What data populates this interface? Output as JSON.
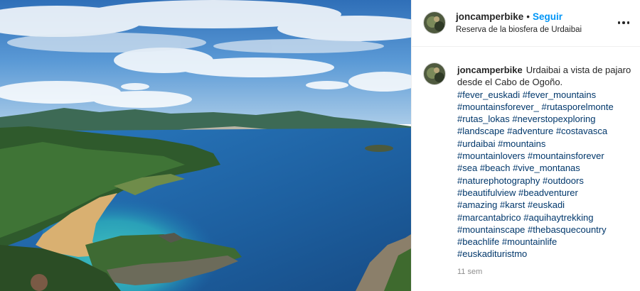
{
  "post": {
    "username": "joncamperbike",
    "separator": "•",
    "follow_label": "Seguir",
    "location": "Reserva de la biosfera de Urdaibai",
    "more_icon": "more-horizontal-icon"
  },
  "caption": {
    "username": "joncamperbike",
    "text": "Urdaibai a vista de pajaro desde el Cabo de Ogoño.",
    "hashtag_lines": [
      [
        "#fever_euskadi",
        "#fever_mountains"
      ],
      [
        "#mountainsforever_",
        "#rutasporelmonte"
      ],
      [
        "#rutas_lokas",
        "#neverstopexploring"
      ],
      [
        "#landscape",
        "#adventure",
        "#costavasca"
      ],
      [
        "#urdaibai",
        "#mountains"
      ],
      [
        "#mountainlovers",
        "#mountainsforever"
      ],
      [
        "#sea",
        "#beach",
        "#vive_montanas"
      ],
      [
        "#naturephotography",
        "#outdoors"
      ],
      [
        "#beautifulview",
        "#beadventurer"
      ],
      [
        "#amazing",
        "#karst",
        "#euskadi"
      ],
      [
        "#marcantabrico",
        "#aquihaytrekking"
      ],
      [
        "#mountainscape",
        "#thebasquecountry"
      ],
      [
        "#beachlife",
        "#mountainlife"
      ],
      [
        "#euskadituristmo"
      ]
    ],
    "timestamp": "11 sem"
  },
  "colors": {
    "follow": "#0095f6",
    "hashtag": "#00376b",
    "muted": "#8e8e8e",
    "sea": "#1f6fb0",
    "sky": "#3f86cc"
  }
}
